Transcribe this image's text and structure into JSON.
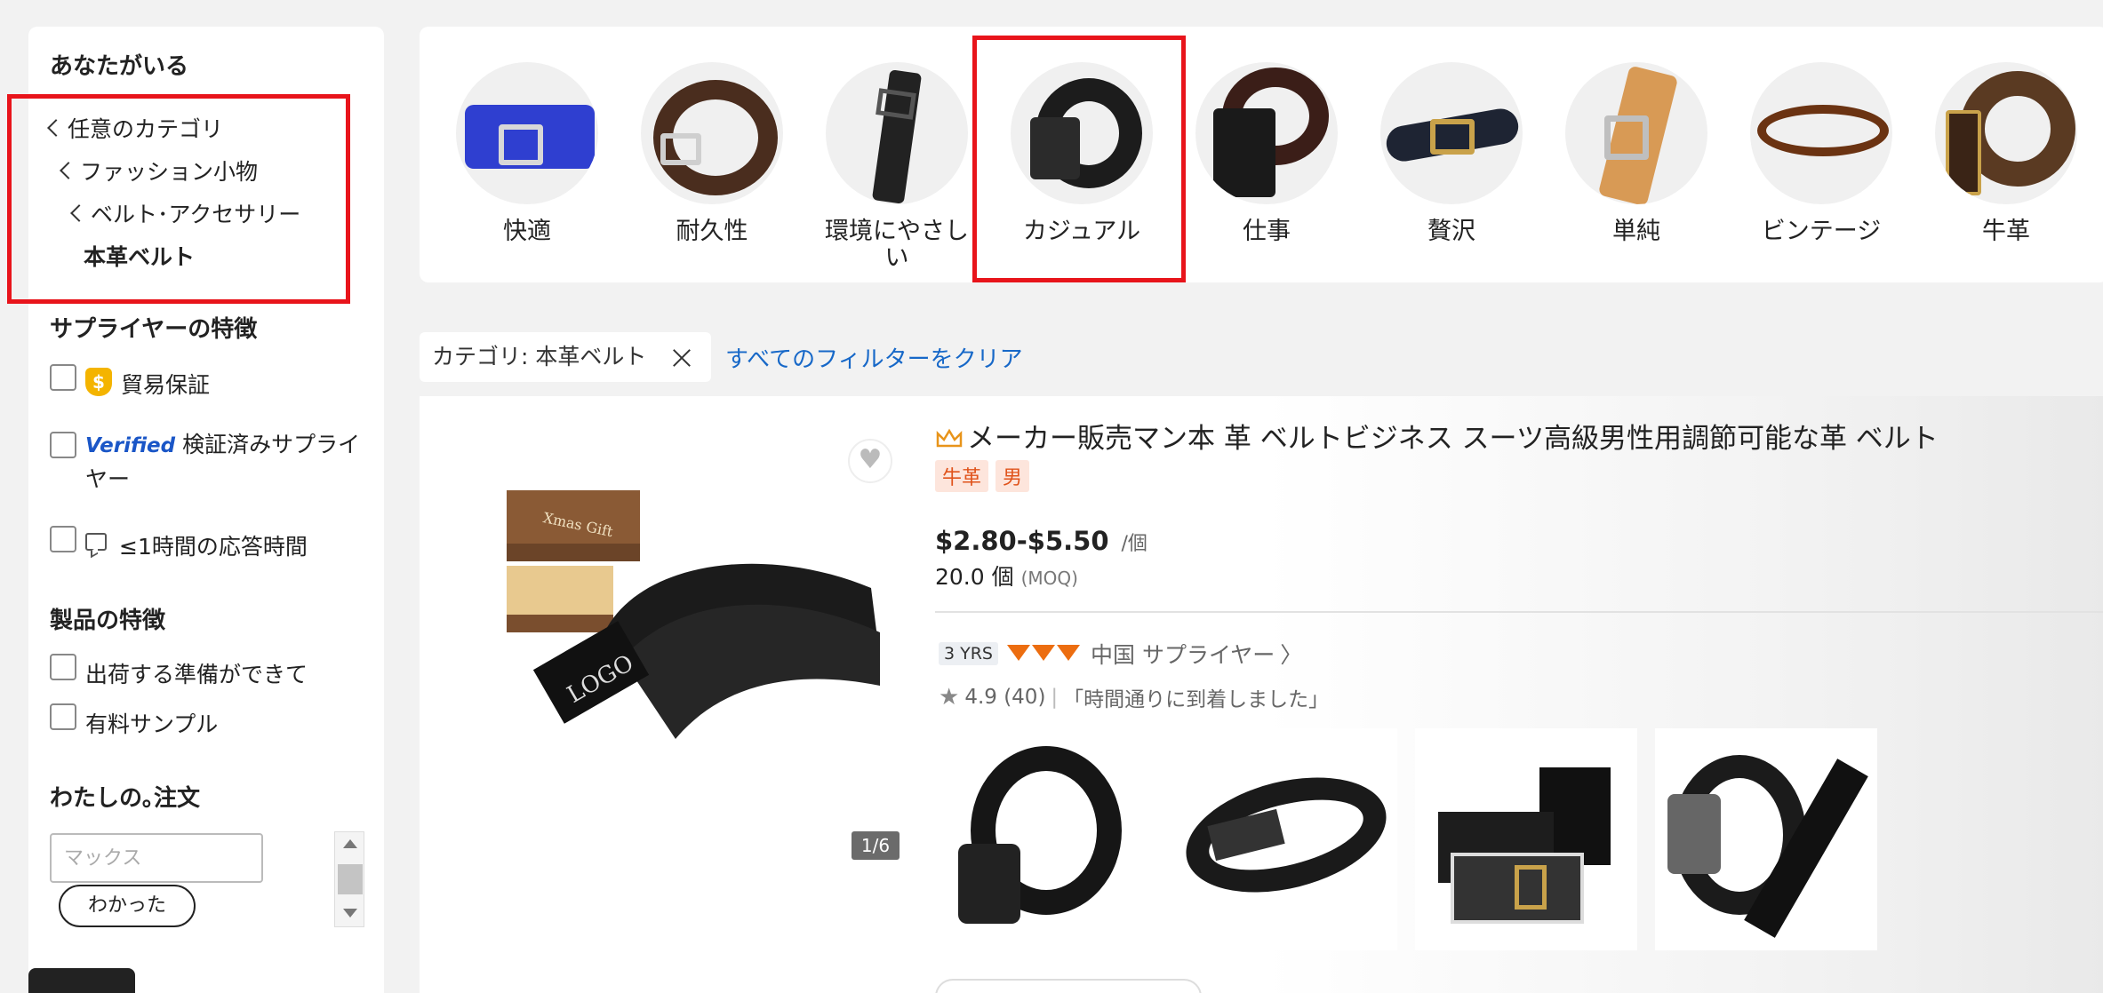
{
  "sidebar": {
    "you_are_here": "あなたがいる",
    "breadcrumbs": [
      {
        "label": "任意のカテゴリ"
      },
      {
        "label": "ファッション小物"
      },
      {
        "label": "ベルト･アクセサリー"
      },
      {
        "label": "本革ベルト"
      }
    ],
    "supplier_features": {
      "title": "サプライヤーの特徴",
      "trade_assurance": "貿易保証",
      "verified_badge": "Verified",
      "verified_label_line1": "検証済みサプライ",
      "verified_label_line2": "ヤー",
      "response_time": "≤1時間の応答時間"
    },
    "product_features": {
      "title": "製品の特徴",
      "ready_to_ship": "出荷する準備ができて",
      "paid_samples": "有料サンプル"
    },
    "my_order": {
      "title": "わたしの｡注文",
      "max_placeholder": "マックス",
      "ok_button": "わかった"
    }
  },
  "categories": [
    {
      "label": "快適"
    },
    {
      "label": "耐久性"
    },
    {
      "label": "環境にやさしい"
    },
    {
      "label": "カジュアル"
    },
    {
      "label": "仕事"
    },
    {
      "label": "贅沢"
    },
    {
      "label": "単純"
    },
    {
      "label": "ビンテージ"
    },
    {
      "label": "牛革"
    }
  ],
  "filters": {
    "chip": "カテゴリ: 本革ベルト",
    "clear_all": "すべてのフィルターをクリア"
  },
  "product": {
    "title": "メーカー販売マン本 革 ベルトビジネス スーツ高級男性用調節可能な革 ベルト",
    "tags": [
      "牛革",
      "男"
    ],
    "price": "$2.80-$5.50",
    "price_unit": "/個",
    "moq_value": "20.0 個",
    "moq_label": "(MOQ)",
    "image_counter": "1/6",
    "image_box_text": "Xmas Gift",
    "image_logo_text": "LOGO",
    "supplier_years": "3 YRS",
    "supplier_country": "中国 サプライヤー",
    "rating": "4.9",
    "rating_count": "(40)",
    "review_snippet": "「時間通りに到着しました」"
  },
  "colors": {
    "highlight_box": "#e8141b",
    "link_blue": "#1768c8",
    "tag_orange": "#e0531b",
    "diamond_orange": "#ec6d10",
    "trade_assurance_gold": "#f4b400"
  }
}
